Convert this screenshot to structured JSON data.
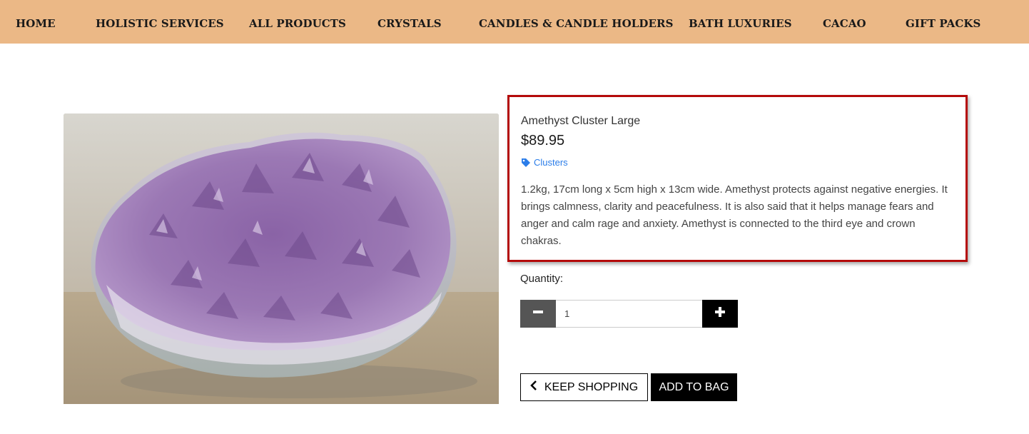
{
  "nav": {
    "items": [
      {
        "label": "HOME"
      },
      {
        "label": "HOLISTIC SERVICES"
      },
      {
        "label": "ALL PRODUCTS"
      },
      {
        "label": "CRYSTALS"
      },
      {
        "label": "CANDLES & CANDLE HOLDERS"
      },
      {
        "label": "BATH LUXURIES"
      },
      {
        "label": "CACAO"
      },
      {
        "label": "GIFT PACKS"
      }
    ],
    "background": "#ebb886"
  },
  "product": {
    "name": "Amethyst Cluster Large",
    "price": "$89.95",
    "category": "Clusters",
    "category_icon": "tag-icon",
    "description": "1.2kg, 17cm long x 5cm high x 13cm wide. Amethyst protects against negative energies. It brings calmness, clarity and peacefulness. It is also said that it helps manage fears and anger and calm rage and anxiety. Amethyst is connected to the third eye and crown chakras.",
    "image_icon": "amethyst-cluster-photo"
  },
  "quantity": {
    "label": "Quantity:",
    "value": "1",
    "minus_icon": "minus-icon",
    "plus_icon": "plus-icon"
  },
  "actions": {
    "keep_shopping": "KEEP SHOPPING",
    "keep_shopping_icon": "chevron-left-icon",
    "add_to_bag": "ADD TO BAG"
  },
  "colors": {
    "highlight_border": "#b40a0a",
    "link": "#2b7de9",
    "minus_button": "#555555",
    "plus_button": "#000000"
  }
}
